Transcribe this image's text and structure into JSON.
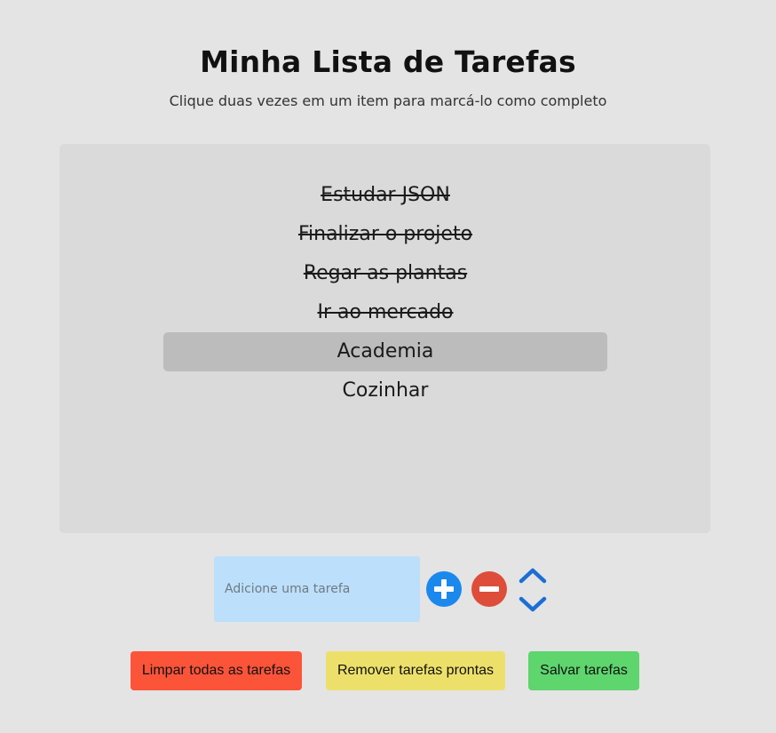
{
  "header": {
    "title": "Minha Lista de Tarefas",
    "subtitle": "Clique duas vezes em um item para marcá-lo como completo"
  },
  "tasks": [
    {
      "label": "Estudar JSON",
      "completed": true,
      "selected": false
    },
    {
      "label": "Finalizar o projeto",
      "completed": true,
      "selected": false
    },
    {
      "label": "Regar as plantas",
      "completed": true,
      "selected": false
    },
    {
      "label": "Ir ao mercado",
      "completed": true,
      "selected": false
    },
    {
      "label": "Academia",
      "completed": false,
      "selected": true
    },
    {
      "label": "Cozinhar",
      "completed": false,
      "selected": false
    }
  ],
  "input": {
    "placeholder": "Adicione uma tarefa",
    "value": ""
  },
  "icons": {
    "add": "plus-circle-icon",
    "remove": "minus-circle-icon",
    "move_up": "chevron-up-icon",
    "move_down": "chevron-down-icon"
  },
  "buttons": {
    "clear_all": "Limpar todas as tarefas",
    "remove_done": "Remover tarefas prontas",
    "save": "Salvar tarefas"
  },
  "colors": {
    "page_background": "#e4e4e4",
    "panel_background": "#dadada",
    "selected_item": "#bcbcbc",
    "input_background": "#bcdffb",
    "add_icon": "#1b88ee",
    "remove_icon": "#de4d3a",
    "arrow_icon": "#1b6fd4",
    "clear_button": "#fc5439",
    "remove_done_button": "#ede06a",
    "save_button": "#5ed56d"
  }
}
